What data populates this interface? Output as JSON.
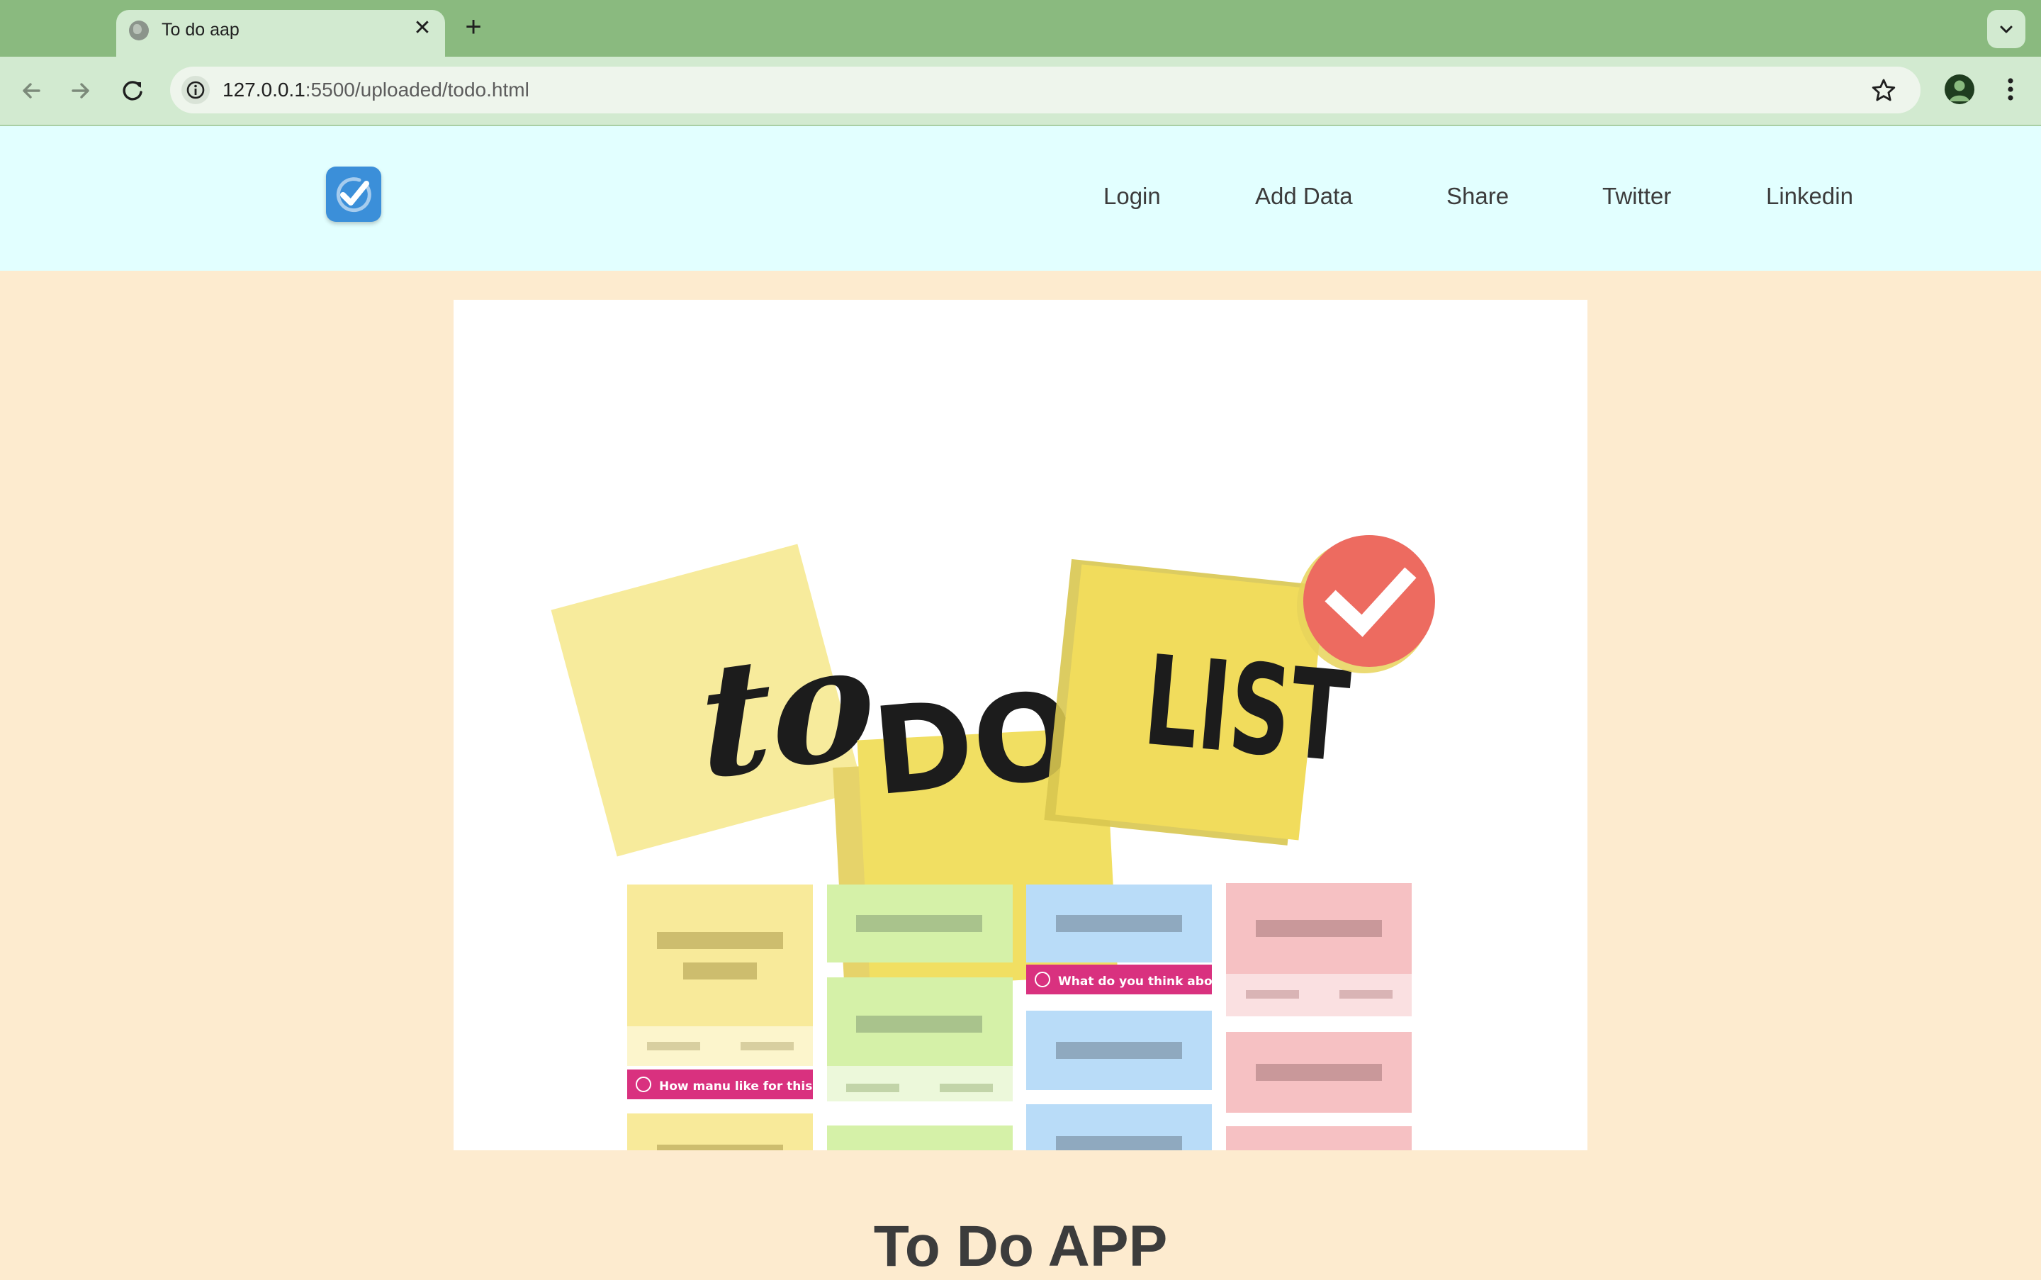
{
  "browser": {
    "tab_title": "To do aap",
    "tab_close_glyph": "✕",
    "new_tab_glyph": "+",
    "url_host": "127.0.0.1",
    "url_rest": ":5500/uploaded/todo.html",
    "icons": [
      "globe-icon",
      "close-icon",
      "plus-icon",
      "chevron-down-icon",
      "back-arrow-icon",
      "forward-arrow-icon",
      "reload-icon",
      "info-icon",
      "star-icon",
      "profile-icon",
      "kebab-menu-icon"
    ]
  },
  "header": {
    "logo_icon": "checkmark-icon",
    "nav": [
      "Login",
      "Add Data",
      "Share",
      "Twitter",
      "Linkedin"
    ]
  },
  "hero": {
    "sticky_words": [
      "to",
      "DO",
      "LIST"
    ],
    "card_labels": [
      "How manu like for this...",
      "What do you think about..."
    ],
    "colors": {
      "yellow_light": "#f7eb9c",
      "yellow": "#f1df62",
      "green": "#d5f1a8",
      "blue": "#b9dcf8",
      "pink": "#f6c1c3",
      "magenta": "#d9317f",
      "check_red": "#ed6b60"
    }
  },
  "main": {
    "title": "To Do APP"
  },
  "colors": {
    "tabstrip": "#8aba7f",
    "toolbar": "#d2ead0",
    "header_bg": "#e2ffff",
    "page_bg": "#fdebcf"
  }
}
